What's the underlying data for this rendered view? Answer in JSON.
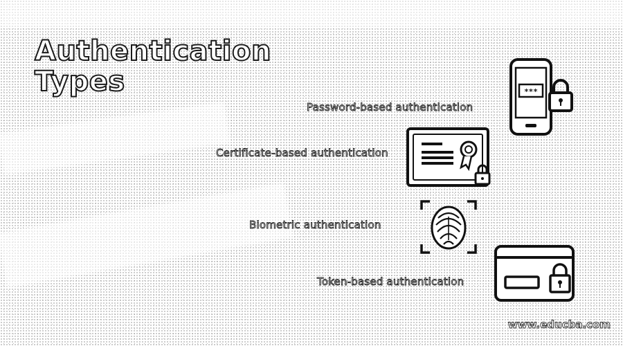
{
  "title": {
    "line1": "Authentication",
    "line2": "Types"
  },
  "items": [
    {
      "label": "Password-based authentication",
      "icon": "phone-lock-icon"
    },
    {
      "label": "Certificate-based authentication",
      "icon": "certificate-icon"
    },
    {
      "label": "Biometric authentication",
      "icon": "fingerprint-icon"
    },
    {
      "label": "Token-based authentication",
      "icon": "card-lock-icon"
    }
  ],
  "footer": {
    "url": "www.educba.com"
  }
}
